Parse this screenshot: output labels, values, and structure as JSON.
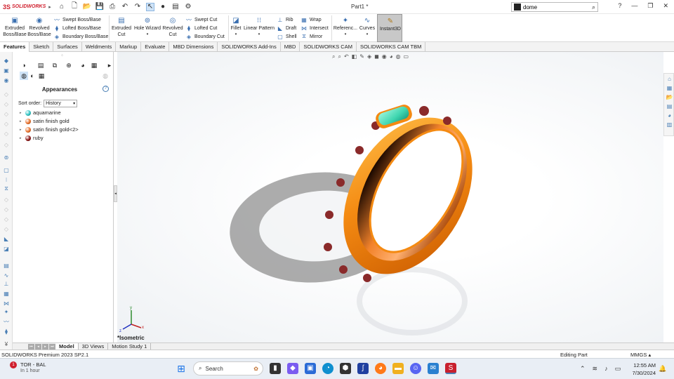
{
  "app": {
    "logo_text": "SOLIDWORKS",
    "document_title": "Part1 *",
    "search_value": "dome"
  },
  "ribbon": {
    "extruded_boss": "Extruded Boss/Base",
    "revolved_boss": "Revolved Boss/Base",
    "swept_boss": "Swept Boss/Base",
    "lofted_boss": "Lofted Boss/Base",
    "boundary_boss": "Boundary Boss/Base",
    "extruded_cut": "Extruded Cut",
    "hole_wizard": "Hole Wizard",
    "revolved_cut": "Revolved Cut",
    "swept_cut": "Swept Cut",
    "lofted_cut": "Lofted Cut",
    "boundary_cut": "Boundary Cut",
    "fillet": "Fillet",
    "linear_pattern": "Linear Pattern",
    "rib": "Rib",
    "draft": "Draft",
    "shell": "Shell",
    "wrap": "Wrap",
    "intersect": "Intersect",
    "mirror": "Mirror",
    "reference": "Referenc...",
    "curves": "Curves",
    "instant3d": "Instant3D"
  },
  "tabs": [
    "Features",
    "Sketch",
    "Surfaces",
    "Weldments",
    "Markup",
    "Evaluate",
    "MBD Dimensions",
    "SOLIDWORKS Add-Ins",
    "MBD",
    "SOLIDWORKS CAM",
    "SOLIDWORKS CAM TBM"
  ],
  "panel": {
    "title": "Appearances",
    "sort_label": "Sort order:",
    "sort_value": "History",
    "items": [
      {
        "label": "aquamarine",
        "color": "#2ec4c4"
      },
      {
        "label": "satin finish gold",
        "color": "#e8702a"
      },
      {
        "label": "satin finish gold<2>",
        "color": "#e8702a"
      },
      {
        "label": "ruby",
        "color": "#8a1414"
      }
    ]
  },
  "viewport": {
    "view_label": "*Isometric",
    "ring_color": "#f48a12",
    "gem_color": "#3fd6b0",
    "stud_color": "#8a2a2a"
  },
  "bottom_tabs": [
    "Model",
    "3D Views",
    "Motion Study 1"
  ],
  "status": {
    "product": "SOLIDWORKS Premium 2023 SP2.1",
    "mode": "Editing Part",
    "units": "MMGS"
  },
  "taskbar": {
    "weather_badge": "1",
    "weather_title": "TOR - BAL",
    "weather_sub": "In 1 hour",
    "search_label": "Search",
    "time": "12:55 AM",
    "date": "7/30/2024"
  }
}
